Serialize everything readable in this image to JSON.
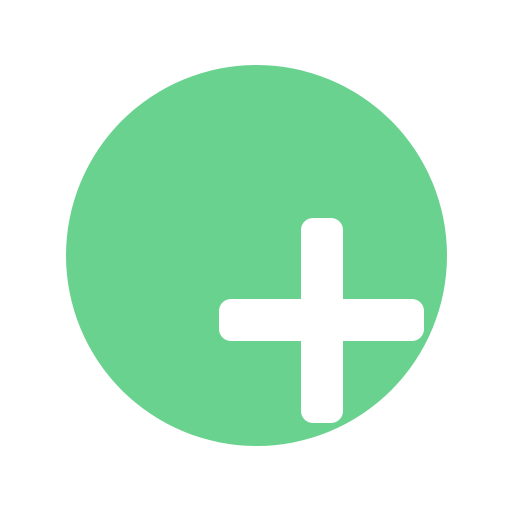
{
  "icon": {
    "name": "plus-icon",
    "shape": "circle-plus"
  },
  "colors": {
    "background": "#ffffff",
    "accent": "#69d28e",
    "glyph": "#ffffff"
  }
}
